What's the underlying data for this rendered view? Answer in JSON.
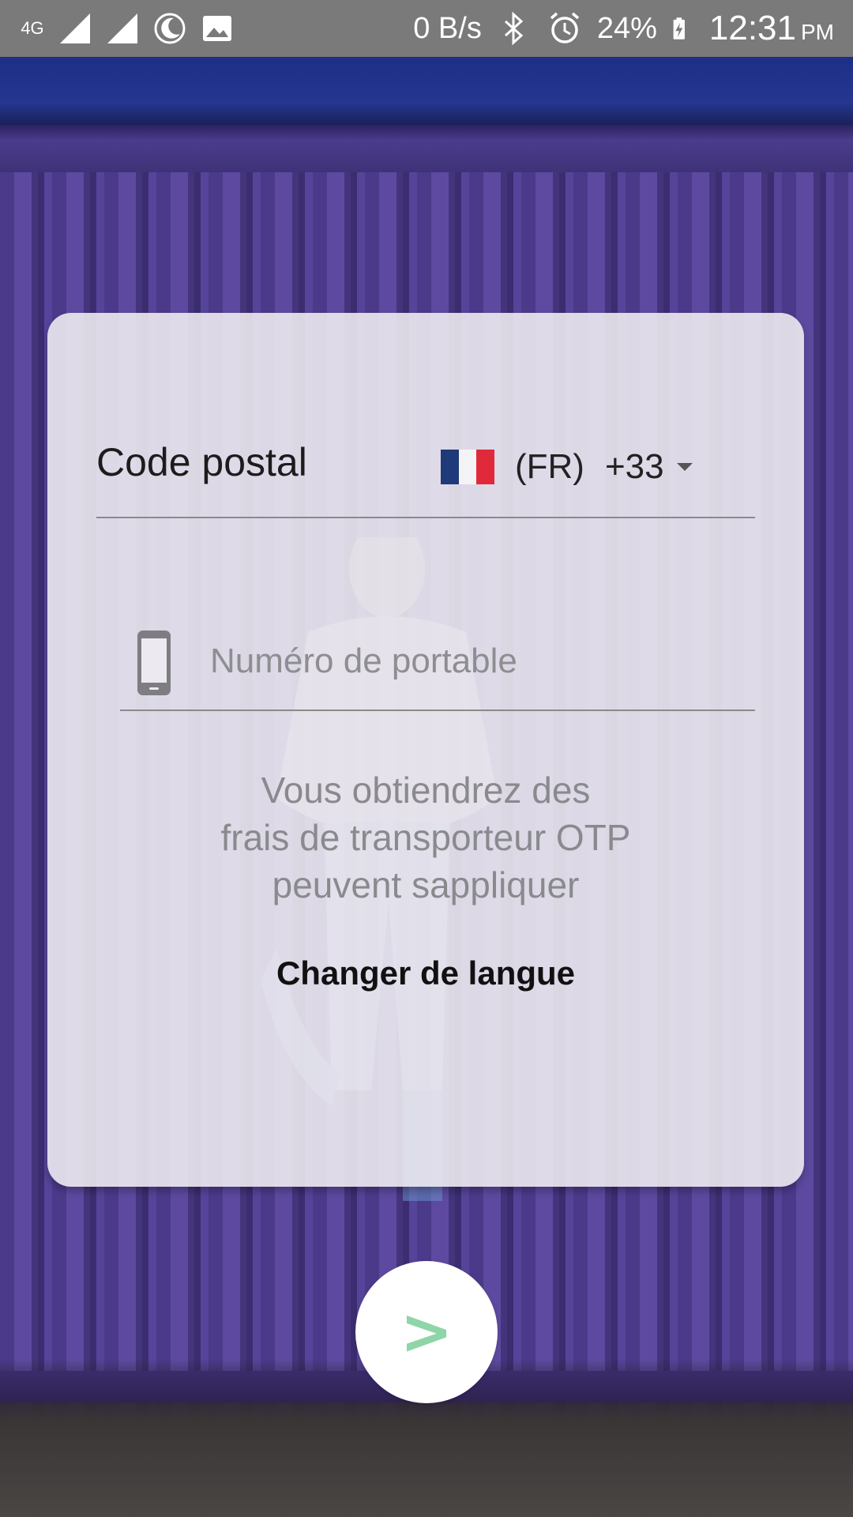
{
  "status_bar": {
    "network_type": "4G",
    "network_speed": "0 B/s",
    "battery": "24%",
    "time": "12:31",
    "ampm": "PM",
    "icons": [
      "signal-sim1-icon",
      "signal-sim2-roaming-icon",
      "night-mode-icon",
      "image-icon",
      "bluetooth-icon",
      "alarm-icon",
      "battery-charging-icon"
    ]
  },
  "form": {
    "postal_label": "Code postal",
    "country_code": "(FR)",
    "dial_code": "+33",
    "phone_placeholder": "Numéro de portable",
    "phone_value": "",
    "info_text": "Vous obtiendrez des\nfrais de transporteur OTP\npeuvent sappliquer",
    "change_language": "Changer de langue",
    "next_label": ">"
  },
  "colors": {
    "accent_next": "#8ed5a8",
    "flag_blue": "#1f3a78",
    "flag_white": "#f4f4f6",
    "flag_red": "#e02a3c"
  }
}
